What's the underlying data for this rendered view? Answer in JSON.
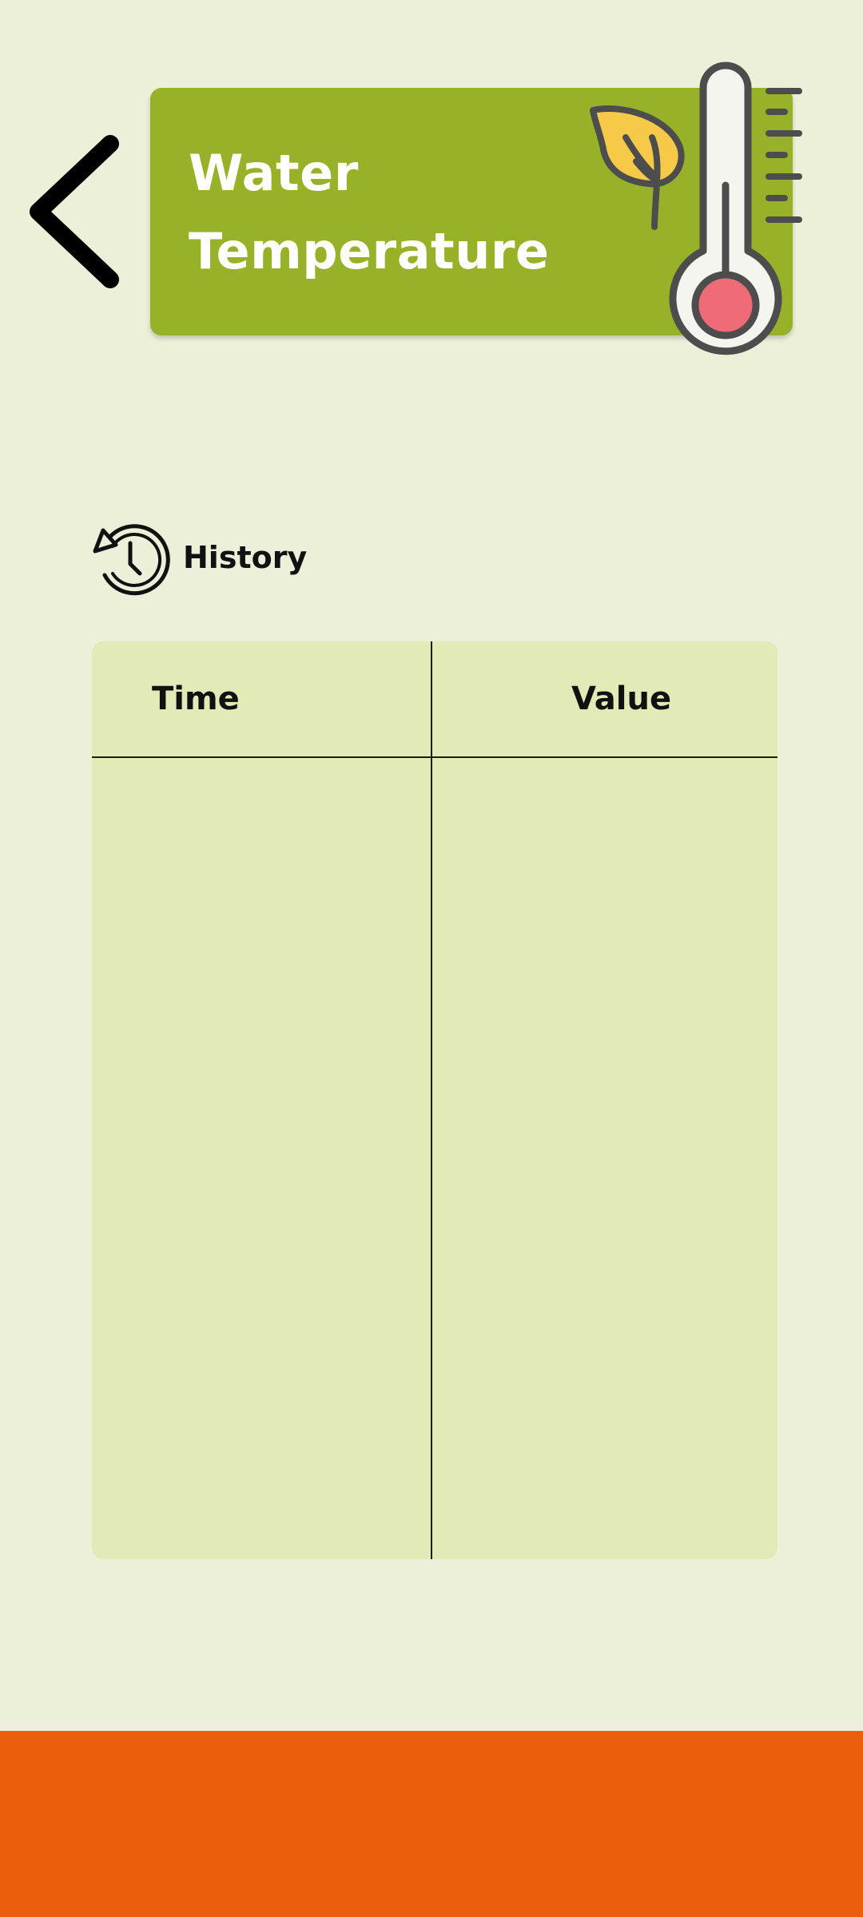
{
  "header": {
    "back_icon": "chevron-left-icon",
    "title_line1": "Water",
    "title_line2": "Temperature",
    "illustration_icon": "thermometer-leaf-icon"
  },
  "history": {
    "icon": "history-icon",
    "label": "History"
  },
  "table": {
    "columns": [
      "Time",
      "Value"
    ],
    "rows": []
  },
  "colors": {
    "background": "#ecf0d8",
    "title_card": "#97b128",
    "table_bg": "#e2eab8",
    "bottom_bar": "#eb5e0d",
    "thermometer_bulb": "#f06b78",
    "leaf": "#f7c948"
  }
}
